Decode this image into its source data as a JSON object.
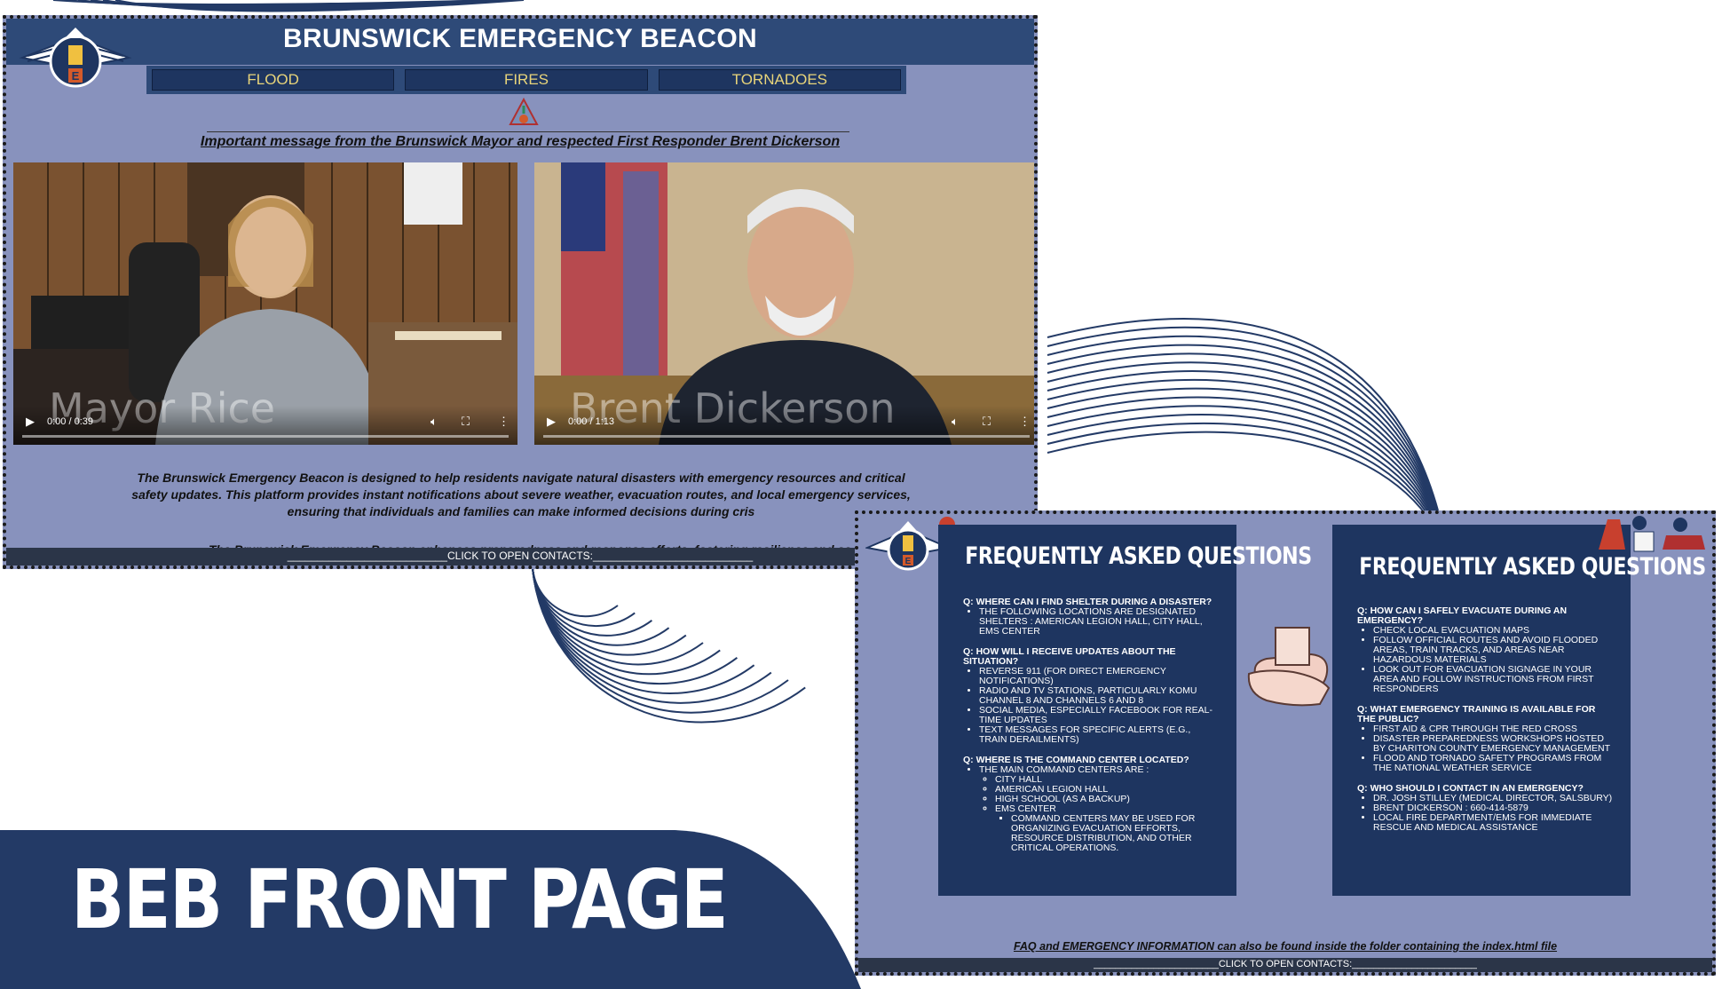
{
  "colors": {
    "navy": "#233a66",
    "panel": "#1e3560",
    "page_bg": "#8892bd",
    "nav_text": "#e8d47a"
  },
  "shot1": {
    "title": "BRUNSWICK EMERGENCY BEACON",
    "nav": [
      "FLOOD",
      "FIRES",
      "TORNADOES"
    ],
    "message": "Important message from the Brunswick Mayor and respected First Responder Brent Dickerson",
    "videos": [
      {
        "caption": "Mayor Rice",
        "time": "0:00 / 0:39"
      },
      {
        "caption": "Brent Dickerson",
        "time": "0:00 / 1:13"
      }
    ],
    "description": "The Brunswick Emergency Beacon is designed to help residents navigate natural disasters with emergency resources and critical safety updates. This platform provides instant notifications about severe weather, evacuation routes, and local emergency services, ensuring that individuals and families can make informed decisions during cris",
    "description2": "The Brunswick Emergency Beacon enhances preparedness and response efforts, fostering resilience and sa",
    "footer": "___________________________CLICK TO OPEN CONTACTS:___________________________"
  },
  "shot2": {
    "faq_title": "FREQUENTLY ASKED QUESTIONS",
    "left": [
      {
        "q": "Q: Where can I find shelter during a disaster?",
        "a": [
          "The following locations are designated shelters : American Legion Hall, City Hall, EMS Center"
        ]
      },
      {
        "q": "Q: How will I receive updates about the situation?",
        "a": [
          "Reverse 911 (for direct emergency notifications)",
          "Radio and TV stations, particularly KOMU Channel 8 and Channels 6 and 8",
          "Social media, especially Facebook for real-time updates",
          "Text messages for specific alerts (e.g., train derailments)"
        ]
      },
      {
        "q": "Q: Where is the Command Center located?",
        "a": [
          "The main Command Centers are :"
        ],
        "sub": [
          "City Hall",
          "American Legion Hall",
          "High School (as a backup)",
          "EMS Center"
        ],
        "subsub": [
          "Command Centers may be used for organizing evacuation efforts, resource distribution, and other critical operations."
        ]
      }
    ],
    "right": [
      {
        "q": "Q: How can I safely evacuate during an emergency?",
        "a": [
          "Check local evacuation maps",
          "Follow official routes and avoid flooded areas, train tracks, and areas near hazardous materials",
          "Look out for evacuation signage in your area and follow instructions from first responders"
        ]
      },
      {
        "q": "Q: What emergency training is available for the public?",
        "a": [
          "First aid & CPR through the Red Cross",
          "Disaster preparedness workshops hosted by Chariton County Emergency Management",
          "Flood and tornado safety programs from the National Weather Service"
        ]
      },
      {
        "q": "Q: Who should I contact in an emergency?",
        "a": [
          "Dr. Josh Stilley (Medical Director, Salsbury)",
          "Brent Dickerson : 660-414-5879",
          "Local fire department/EMS for immediate rescue and medical assistance"
        ]
      }
    ],
    "note": "FAQ and EMERGENCY INFORMATION can also be found inside the folder containing the index.html file",
    "footer": "_______________________CLICK TO OPEN CONTACTS:_______________________"
  },
  "banner": {
    "title": "BEB FRONT PAGE"
  },
  "logo_letter": "E"
}
